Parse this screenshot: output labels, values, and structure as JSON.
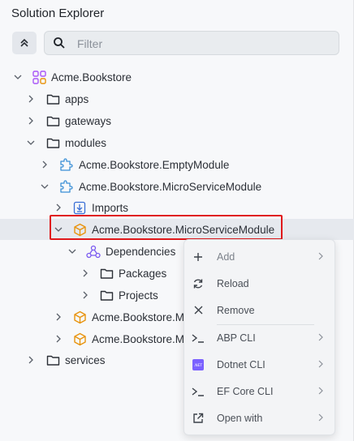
{
  "panel": {
    "title": "Solution Explorer"
  },
  "search": {
    "placeholder": "Filter",
    "value": ""
  },
  "tree": {
    "root": "Acme.Bookstore",
    "apps": "apps",
    "gateways": "gateways",
    "modules": "modules",
    "empty_module": "Acme.Bookstore.EmptyModule",
    "microservice_module": "Acme.Bookstore.MicroServiceModule",
    "imports": "Imports",
    "selected_item": "Acme.Bookstore.MicroServiceModule",
    "dependencies": "Dependencies",
    "packages": "Packages",
    "projects": "Projects",
    "truncated_item_1": "Acme.Bookstore.M",
    "truncated_item_2": "Acme.Bookstore.M",
    "services": "services"
  },
  "context_menu": {
    "items": [
      {
        "label": "Add",
        "icon": "plus-icon",
        "submenu": true,
        "enabled": false
      },
      {
        "label": "Reload",
        "icon": "reload-icon",
        "submenu": false,
        "enabled": true
      },
      {
        "label": "Remove",
        "icon": "close-icon",
        "submenu": false,
        "enabled": true
      },
      {
        "label": "ABP CLI",
        "icon": "terminal-icon",
        "submenu": true,
        "enabled": true
      },
      {
        "label": "Dotnet CLI",
        "icon": "dotnet-icon",
        "submenu": true,
        "enabled": true
      },
      {
        "label": "EF Core CLI",
        "icon": "terminal-icon",
        "submenu": true,
        "enabled": true
      },
      {
        "label": "Open with",
        "icon": "open-external-icon",
        "submenu": true,
        "enabled": true
      }
    ]
  },
  "colors": {
    "accent_highlight": "#e0191b",
    "module_icon": "#e8930c",
    "csproj_icon": "#3a8fd6",
    "dependency_icon": "#7a5af0",
    "solution_icon": "#a855f7",
    "dotnet_badge": "#7b61ff"
  }
}
